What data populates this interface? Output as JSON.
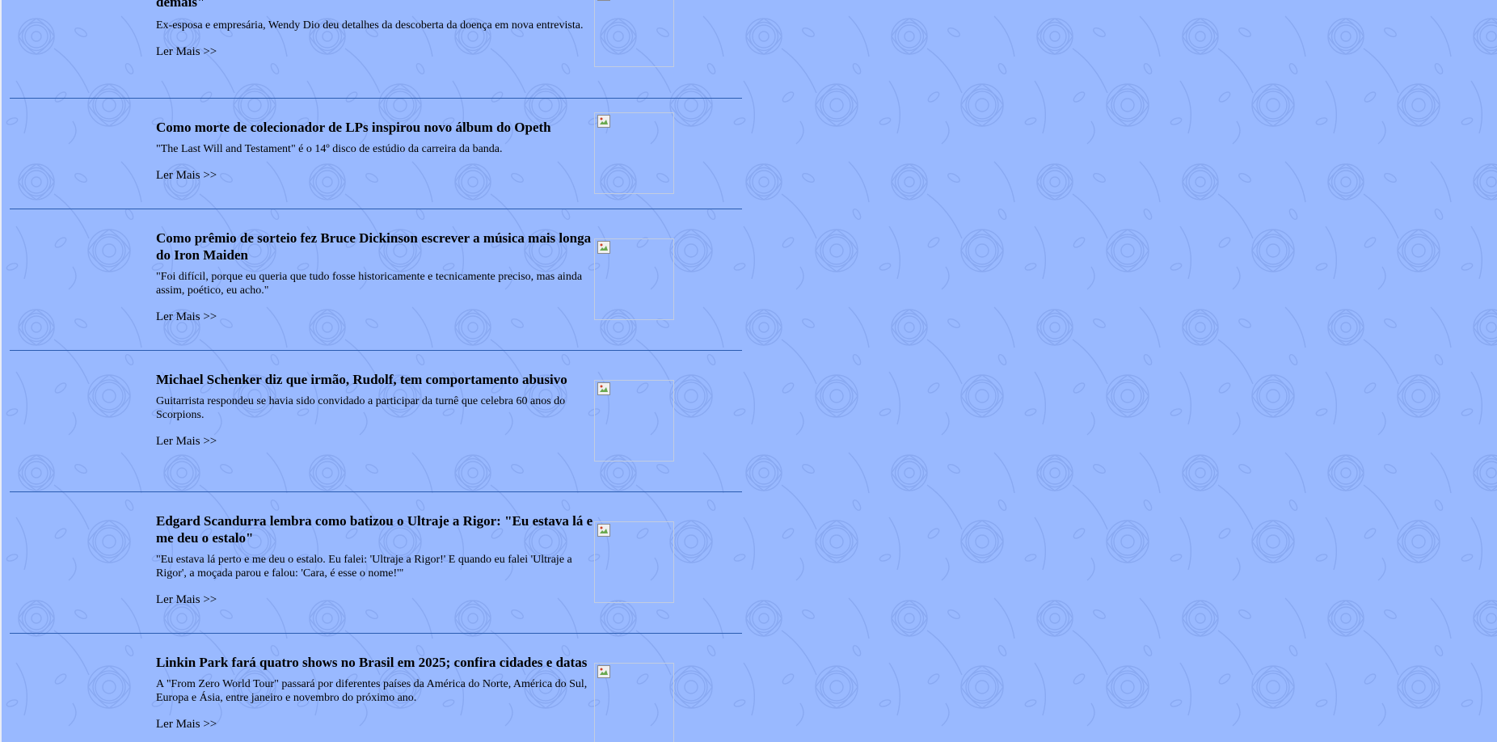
{
  "colors": {
    "background": "#99b9ff",
    "divider": "#2a5cb0",
    "text": "#000000"
  },
  "articles": [
    {
      "title_tail": "demais\"",
      "summary": "Ex-esposa e empresária, Wendy Dio deu detalhes da descoberta da doença em nova entrevista.",
      "read_more": "Ler Mais >>",
      "thumbnail_icon": "broken-image-icon"
    },
    {
      "title": "Como morte de colecionador de LPs inspirou novo álbum do Opeth",
      "summary": "\"The Last Will and Testament\" é o 14º disco de estúdio da carreira da banda.",
      "read_more": "Ler Mais >>",
      "thumbnail_icon": "broken-image-icon"
    },
    {
      "title": "Como prêmio de sorteio fez Bruce Dickinson escrever a música mais longa do Iron Maiden",
      "summary": "\"Foi difícil, porque eu queria que tudo fosse historicamente e tecnicamente preciso, mas ainda assim, poético, eu acho.\"",
      "read_more": "Ler Mais >>",
      "thumbnail_icon": "broken-image-icon"
    },
    {
      "title": "Michael Schenker diz que irmão, Rudolf, tem comportamento abusivo",
      "summary": "Guitarrista respondeu se havia sido convidado a participar da turnê que celebra 60 anos do Scorpions.",
      "read_more": "Ler Mais >>",
      "thumbnail_icon": "broken-image-icon"
    },
    {
      "title": "Edgard Scandurra lembra como batizou o Ultraje a Rigor: \"Eu estava lá e me deu o estalo\"",
      "summary": "\"Eu estava lá perto e me deu o estalo. Eu falei: 'Ultraje a Rigor!' E quando eu falei 'Ultraje a Rigor', a moçada parou e falou: 'Cara, é esse o nome!'\"",
      "read_more": "Ler Mais >>",
      "thumbnail_icon": "broken-image-icon"
    },
    {
      "title": "Linkin Park fará quatro shows no Brasil em 2025; confira cidades e datas",
      "summary": "A \"From Zero World Tour\" passará por diferentes países da América do Norte, América do Sul, Europa e Ásia, entre janeiro e novembro do próximo ano.",
      "read_more": "Ler Mais >>",
      "thumbnail_icon": "broken-image-icon"
    }
  ]
}
